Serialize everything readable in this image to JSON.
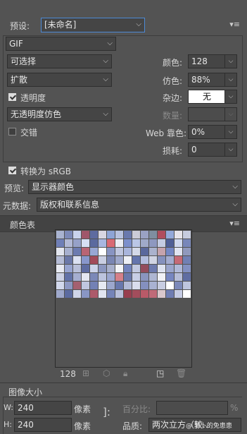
{
  "preset": {
    "label": "预设:",
    "value": "[未命名]"
  },
  "format": {
    "value": "GIF"
  },
  "reduction": {
    "value": "可选择"
  },
  "dither_algo": {
    "value": "扩散"
  },
  "transparency": {
    "label": "透明度",
    "checked": true
  },
  "trans_dither": {
    "value": "无透明度仿色"
  },
  "interlaced": {
    "label": "交错",
    "checked": false
  },
  "colors": {
    "label": "颜色:",
    "value": "128"
  },
  "dither": {
    "label": "仿色:",
    "value": "88%"
  },
  "matte": {
    "label": "杂边:",
    "value": "无"
  },
  "amount": {
    "label": "数量:",
    "value": ""
  },
  "web_snap": {
    "label": "Web 靠色:",
    "value": "0%"
  },
  "lossy": {
    "label": "损耗:",
    "value": "0"
  },
  "convert_srgb": {
    "label": "转换为 sRGB",
    "checked": true
  },
  "preview": {
    "label": "预览:",
    "value": "显示器颜色"
  },
  "metadata": {
    "label": "元数据:",
    "value": "版权和联系信息"
  },
  "color_table": {
    "title": "颜色表",
    "count": "128",
    "colors": [
      "#a9b3d0",
      "#7d8ab8",
      "#c9d3ec",
      "#a0566a",
      "#5e6ba0",
      "#d8d6e2",
      "#8ea4d6",
      "#b8c2df",
      "#6a79ad",
      "#cbcbd6",
      "#9aa2c3",
      "#7f8ea0",
      "#b04d5d",
      "#94a9d9",
      "#e7e4ea",
      "#c7ccde",
      "#6f7fb7",
      "#b2b9d6",
      "#96a1c8",
      "#d6e0f4",
      "#5b6a9f",
      "#a8b6e0",
      "#d96a74",
      "#ecedf4",
      "#7c8fcc",
      "#bac6e6",
      "#9fa9c9",
      "#8e98c0",
      "#c4cbe2",
      "#4f5f96",
      "#cfd8ef",
      "#7887ba",
      "#e3e6ef",
      "#a7b0cf",
      "#6c7bb0",
      "#b86474",
      "#98a7d4",
      "#ffffff",
      "#8894c2",
      "#bfc6df",
      "#a9b5dc",
      "#d4d9e8",
      "#5a689c",
      "#aab2cd",
      "#c5a3ad",
      "#7487c4",
      "#e0e4f1",
      "#9099bd",
      "#b5bcd6",
      "#6b78a8",
      "#dbe1f2",
      "#8897cc",
      "#a24a5a",
      "#c9cee2",
      "#7a86b3",
      "#9ea8cb",
      "#eef0f6",
      "#6475ad",
      "#b3bdde",
      "#d0d4e3",
      "#8591bd",
      "#a3acd0",
      "#c56a76",
      "#7180b4",
      "#e8eaf2",
      "#97a4d0",
      "#b8bfd9",
      "#5e6ca1",
      "#ccd3ea",
      "#8b96bf",
      "#a8b0cc",
      "#f4f5f8",
      "#7384bd",
      "#c2c9e1",
      "#934c5c",
      "#6d7aae",
      "#dde2f0",
      "#9aa5cc",
      "#b0b9d8",
      "#8290c2",
      "#cdd2e5",
      "#6272a8",
      "#a5aed0",
      "#e4e7f0",
      "#7b88b8",
      "#bcc3dd",
      "#9ba6cf",
      "#d58089",
      "#6a78ab",
      "#c8cfe6",
      "#8a95be",
      "#aeb6d2",
      "#f0f1f6",
      "#7686c0",
      "#b6bdd8",
      "#5f6da2",
      "#d2d8ec",
      "#8d98c3",
      "#a46070",
      "#c0c7df",
      "#7381b5",
      "#e6e9f2",
      "#9ca7cd",
      "#6877ac",
      "#b2bad7",
      "#d9dded",
      "#8490bf",
      "#a9b2d2",
      "#c8cde1",
      "#ffffff",
      "#7c89b9",
      "#bec5de",
      "#9fa9cc",
      "#5c6ba0",
      "#cfd5e9",
      "#8996c4",
      "#ac5a6a",
      "#e1e5f0",
      "#7584b8",
      "#b9c0db",
      "#983f4f",
      "#a34d5c",
      "#b85a68",
      "#c06a78",
      "#d9c7cc",
      "#6f7db2",
      "#c6cce4",
      "#ffffff"
    ]
  },
  "color_table_icons": [
    "map-to-web-icon",
    "web-shift-icon",
    "lock-icon",
    "new-color-icon",
    "trash-icon"
  ],
  "image_size": {
    "title": "图像大小",
    "w_label": "W:",
    "w_value": "240",
    "w_unit": "像素",
    "h_label": "H:",
    "h_value": "240",
    "h_unit": "像素",
    "percent_label": "百分比:",
    "percent_value": "",
    "percent_unit": "%",
    "quality_label": "品质:",
    "quality_value": "两次立方（较...",
    "watermark": "@ 萝卜的免患患"
  }
}
